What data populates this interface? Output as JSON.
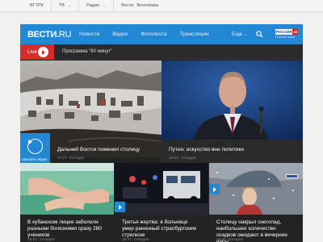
{
  "topbar": {
    "items": [
      {
        "label": "ВГТРК",
        "has_menu": false
      },
      {
        "label": "ТВ",
        "has_menu": true
      },
      {
        "label": "Радио",
        "has_menu": true
      },
      {
        "label": "Вести. Экономика",
        "has_menu": false
      }
    ]
  },
  "nav": {
    "logo_main": "ВЕСТИ",
    "logo_dot": ".",
    "logo_ru": "RU",
    "items": [
      "Новости",
      "Видео",
      "Фотолента",
      "Трансляции"
    ],
    "more": "Еще",
    "channel": {
      "name": "РОССИЯ",
      "number": "24",
      "subtitle": "Главный эфир"
    }
  },
  "live": {
    "badge": "Live",
    "program": "Программа \"60 минут\""
  },
  "featured": [
    {
      "title": "Дальний Восток поменял столицу",
      "time": "17:27",
      "date": "Сегодня",
      "watch_label": "Смотреть видео",
      "has_video": true
    },
    {
      "title": "Путин: искусство вне политики",
      "time": "18:23",
      "date": "Сегодня",
      "has_video": false
    }
  ],
  "news": [
    {
      "title": "В кубанском лицее заболели разными болезнями сразу 280 учеников",
      "time": "18:52",
      "date": "Сегодня",
      "has_video": false
    },
    {
      "title": "Третья жертва: в больнице умер раненный страсбургским стрелком",
      "time": "18:37",
      "date": "Сегодня",
      "has_video": true
    },
    {
      "title": "Столицу накрыл снегопад, наибольшее количество осадков ожидают в вечерние часы",
      "time": "18:32",
      "date": "Сегодня",
      "has_video": true
    }
  ],
  "colors": {
    "brand_blue": "#2288d6",
    "live_red": "#d52b2b"
  }
}
